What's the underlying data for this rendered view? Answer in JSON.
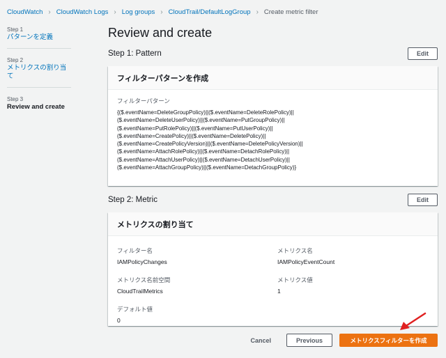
{
  "breadcrumb": {
    "items": [
      "CloudWatch",
      "CloudWatch Logs",
      "Log groups",
      "CloudTrail/DefaultLogGroup"
    ],
    "current": "Create metric filter"
  },
  "steps": [
    {
      "num": "Step 1",
      "label": "パターンを定義"
    },
    {
      "num": "Step 2",
      "label": "メトリクスの割り当て"
    },
    {
      "num": "Step 3",
      "label": "Review and create"
    }
  ],
  "page_title": "Review and create",
  "pattern_section": {
    "title": "Step 1: Pattern",
    "edit_label": "Edit",
    "card_title": "フィルターパターンを作成",
    "field_label": "フィルターパターン",
    "lines": [
      "{($.eventName=DeleteGroupPolicy)||($.eventName=DeleteRolePolicy)||",
      "($.eventName=DeleteUserPolicy)||($.eventName=PutGroupPolicy)||",
      "($.eventName=PutRolePolicy)||($.eventName=PutUserPolicy)||",
      "($.eventName=CreatePolicy)||($.eventName=DeletePolicy)||",
      "($.eventName=CreatePolicyVersion)||($.eventName=DeletePolicyVersion)||",
      "($.eventName=AttachRolePolicy)||($.eventName=DetachRolePolicy)||",
      "($.eventName=AttachUserPolicy)||($.eventName=DetachUserPolicy)||",
      "($.eventName=AttachGroupPolicy)||($.eventName=DetachGroupPolicy)}"
    ]
  },
  "metric_section": {
    "title": "Step 2: Metric",
    "edit_label": "Edit",
    "card_title": "メトリクスの割り当て",
    "filter_name_label": "フィルター名",
    "filter_name": "IAMPolicyChanges",
    "metric_name_label": "メトリクス名",
    "metric_name": "IAMPolicyEventCount",
    "namespace_label": "メトリクス名前空間",
    "namespace": "CloudTrailMetrics",
    "metric_value_label": "メトリクス値",
    "metric_value": "1",
    "default_value_label": "デフォルト値",
    "default_value": "0"
  },
  "footer": {
    "cancel": "Cancel",
    "previous": "Previous",
    "create": "メトリクスフィルターを作成"
  },
  "colors": {
    "link": "#0073bb",
    "primary": "#ec7211",
    "annotation_arrow": "#e02020"
  }
}
